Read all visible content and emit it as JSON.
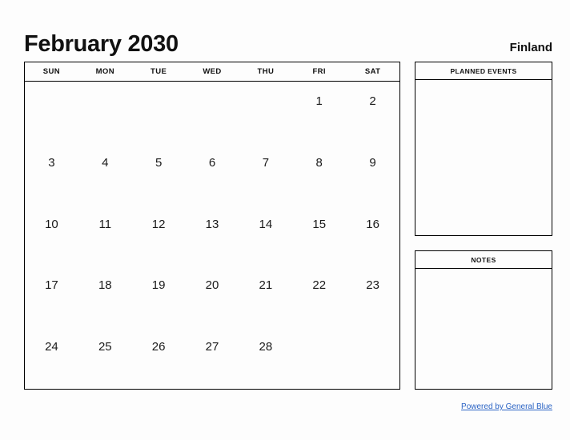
{
  "header": {
    "month_title": "February 2030",
    "country": "Finland"
  },
  "calendar": {
    "weekdays": [
      "SUN",
      "MON",
      "TUE",
      "WED",
      "THU",
      "FRI",
      "SAT"
    ],
    "weeks": [
      [
        "",
        "",
        "",
        "",
        "",
        "1",
        "2"
      ],
      [
        "3",
        "4",
        "5",
        "6",
        "7",
        "8",
        "9"
      ],
      [
        "10",
        "11",
        "12",
        "13",
        "14",
        "15",
        "16"
      ],
      [
        "17",
        "18",
        "19",
        "20",
        "21",
        "22",
        "23"
      ],
      [
        "24",
        "25",
        "26",
        "27",
        "28",
        "",
        ""
      ]
    ]
  },
  "panels": {
    "planned_events": {
      "title": "PLANNED EVENTS",
      "content": ""
    },
    "notes": {
      "title": "NOTES",
      "content": ""
    }
  },
  "footer": {
    "link_label": "Powered by General Blue"
  },
  "colors": {
    "page_background": "#fdfdfd",
    "border": "#000000",
    "text": "#1a1a1a",
    "link": "#2a63c4"
  }
}
